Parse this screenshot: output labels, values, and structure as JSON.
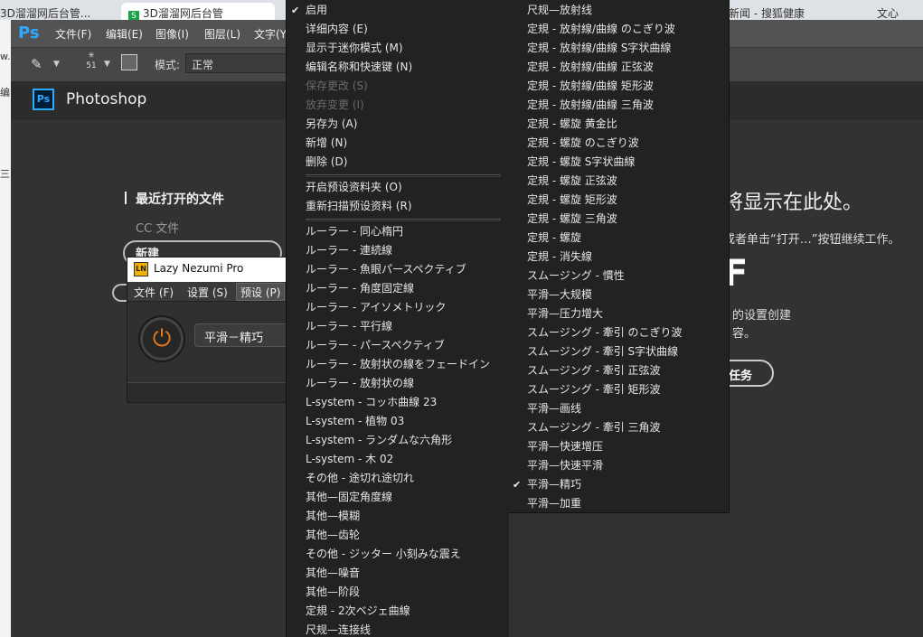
{
  "browser": {
    "tabs": [
      "3D溜溜网后台管...",
      "3D溜溜网后台管",
      "",
      "新闻 - 搜狐健康",
      "文心"
    ],
    "left_chars": [
      "w.",
      "编",
      "三"
    ]
  },
  "photoshop": {
    "logo": "Ps",
    "menus": [
      "文件(F)",
      "编辑(E)",
      "图像(I)",
      "图层(L)",
      "文字(Y)"
    ],
    "brush_size": "51",
    "mode_label": "模式:",
    "mode_value": "正常"
  },
  "home": {
    "logo": "Ps",
    "title": "Photoshop",
    "recent_files": "最近打开的文件",
    "cc_files": "CC 文件",
    "new_button": "新建",
    "right_big_text": "将显示在此处。",
    "right_sub_text": "或者单击“打开…”按钮继续工作。",
    "right_glyph": "F",
    "right_text3": "的设置创建",
    "right_text4": "容。",
    "task_button": "任务"
  },
  "lazy_nezumi": {
    "logo": "LN",
    "title": "Lazy Nezumi Pro",
    "menus": [
      "文件 (F)",
      "设置 (S)",
      "预设 (P)"
    ],
    "power_icon": "⏻",
    "preset_value": "平滑－精巧"
  },
  "menu_left": {
    "items": [
      {
        "label": "启用",
        "checked": true
      },
      {
        "label": "详细内容 (E)"
      },
      {
        "label": "显示于迷你模式 (M)"
      },
      {
        "label": "编辑名称和快速键 (N)"
      },
      {
        "label": "保存更改 (S)",
        "disabled": true
      },
      {
        "label": "放弃变更 (I)",
        "disabled": true
      },
      {
        "label": "另存为 (A)"
      },
      {
        "label": "新增 (N)"
      },
      {
        "label": "删除 (D)"
      },
      {
        "separator": true
      },
      {
        "label": "开启预设资料夹 (O)"
      },
      {
        "label": "重新扫描预设资料 (R)"
      },
      {
        "separator": true
      },
      {
        "label": "ルーラー - 同心楕円"
      },
      {
        "label": "ルーラー - 連続線"
      },
      {
        "label": "ルーラー - 魚眼パースペクティブ"
      },
      {
        "label": "ルーラー - 角度固定線"
      },
      {
        "label": "ルーラー - アイソメトリック"
      },
      {
        "label": "ルーラー - 平行線"
      },
      {
        "label": "ルーラー - パースペクティブ"
      },
      {
        "label": "ルーラー - 放射状の線をフェードイン"
      },
      {
        "label": "ルーラー - 放射状の線"
      },
      {
        "label": "L-system - コッホ曲線 23"
      },
      {
        "label": "L-system - 植物 03"
      },
      {
        "label": "L-system - ランダムな六角形"
      },
      {
        "label": "L-system - 木 02"
      },
      {
        "label": "その他 - 途切れ途切れ"
      },
      {
        "label": "其他—固定角度線"
      },
      {
        "label": "其他—模糊"
      },
      {
        "label": "其他—齿轮"
      },
      {
        "label": "その他 - ジッター 小刻みな震え"
      },
      {
        "label": "其他—噪音"
      },
      {
        "label": "其他—阶段"
      },
      {
        "label": "定規 - 2次ベジェ曲線"
      },
      {
        "label": "尺规—连接线"
      }
    ]
  },
  "menu_right": {
    "items": [
      {
        "label": "尺规—放射线"
      },
      {
        "label": "定規 - 放射線/曲線 のこぎり波"
      },
      {
        "label": "定規 - 放射線/曲線 S字状曲線"
      },
      {
        "label": "定規 - 放射線/曲線 正弦波"
      },
      {
        "label": "定規 - 放射線/曲線 矩形波"
      },
      {
        "label": "定規 - 放射線/曲線 三角波"
      },
      {
        "label": "定規 - 螺旋 黄金比"
      },
      {
        "label": "定規 - 螺旋 のこぎり波"
      },
      {
        "label": "定規 - 螺旋 S字状曲線"
      },
      {
        "label": "定規 - 螺旋 正弦波"
      },
      {
        "label": "定規 - 螺旋 矩形波"
      },
      {
        "label": "定規 - 螺旋 三角波"
      },
      {
        "label": "定規 - 螺旋"
      },
      {
        "label": "定規 - 消失線"
      },
      {
        "label": "スムージング - 慣性"
      },
      {
        "label": "平滑—大规模"
      },
      {
        "label": "平滑—压力增大"
      },
      {
        "label": "スムージング - 牽引 のこぎり波"
      },
      {
        "label": "スムージング - 牽引 S字状曲線"
      },
      {
        "label": "スムージング - 牽引 正弦波"
      },
      {
        "label": "スムージング - 牽引 矩形波"
      },
      {
        "label": "平滑—画线"
      },
      {
        "label": "スムージング - 牽引 三角波"
      },
      {
        "label": "平滑—快速增压"
      },
      {
        "label": "平滑—快速平滑"
      },
      {
        "label": "平滑—精巧",
        "checked": true
      },
      {
        "label": "平滑—加重"
      }
    ]
  }
}
